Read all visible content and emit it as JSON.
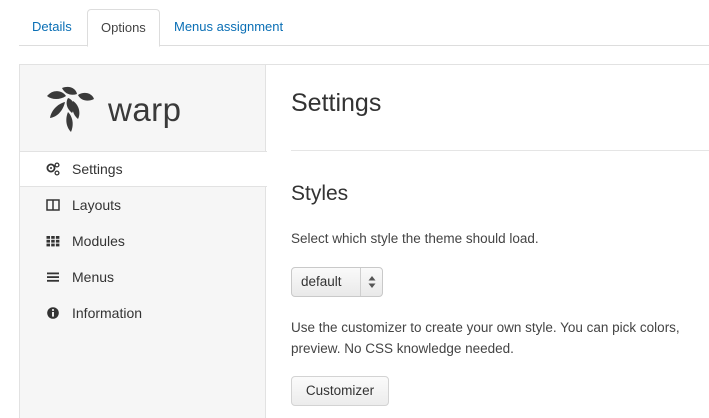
{
  "tabs": [
    {
      "label": "Details",
      "active": false
    },
    {
      "label": "Options",
      "active": true
    },
    {
      "label": "Menus assignment",
      "active": false
    }
  ],
  "sidebar": {
    "logo_text": "warp",
    "items": [
      {
        "label": "Settings",
        "icon": "cogs-icon",
        "active": true
      },
      {
        "label": "Layouts",
        "icon": "columns-icon",
        "active": false
      },
      {
        "label": "Modules",
        "icon": "grid-icon",
        "active": false
      },
      {
        "label": "Menus",
        "icon": "list-icon",
        "active": false
      },
      {
        "label": "Information",
        "icon": "info-icon",
        "active": false
      }
    ]
  },
  "main": {
    "title": "Settings",
    "styles": {
      "heading": "Styles",
      "description": "Select which style the theme should load.",
      "select_value": "default",
      "customizer_text": "Use the customizer to create your own style. You can pick colors, preview. No CSS knowledge needed.",
      "customizer_button": "Customizer"
    }
  },
  "colors": {
    "link": "#0a6fb5",
    "sidebar_bg": "#f6f6f6",
    "text": "#333333"
  }
}
